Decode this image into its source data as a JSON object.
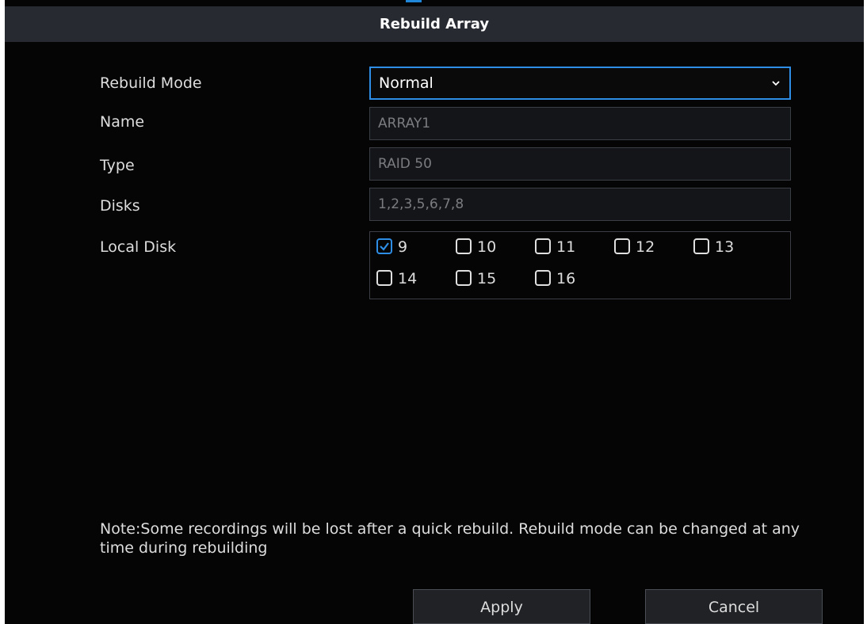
{
  "dialog": {
    "title": "Rebuild Array"
  },
  "form": {
    "rebuild_mode_label": "Rebuild Mode",
    "rebuild_mode_value": "Normal",
    "name_label": "Name",
    "name_value": "ARRAY1",
    "type_label": "Type",
    "type_value": "RAID 50",
    "disks_label": "Disks",
    "disks_value": "1,2,3,5,6,7,8",
    "local_disk_label": "Local Disk"
  },
  "local_disks": [
    {
      "label": "9",
      "checked": true
    },
    {
      "label": "10",
      "checked": false
    },
    {
      "label": "11",
      "checked": false
    },
    {
      "label": "12",
      "checked": false
    },
    {
      "label": "13",
      "checked": false
    },
    {
      "label": "14",
      "checked": false
    },
    {
      "label": "15",
      "checked": false
    },
    {
      "label": "16",
      "checked": false
    }
  ],
  "note": "Note:Some recordings will be lost after a quick rebuild. Rebuild mode can be changed at any time during rebuilding",
  "buttons": {
    "apply": "Apply",
    "cancel": "Cancel"
  },
  "colors": {
    "accent": "#2e8ee6",
    "background": "#050505",
    "title_bar": "#272a30"
  }
}
